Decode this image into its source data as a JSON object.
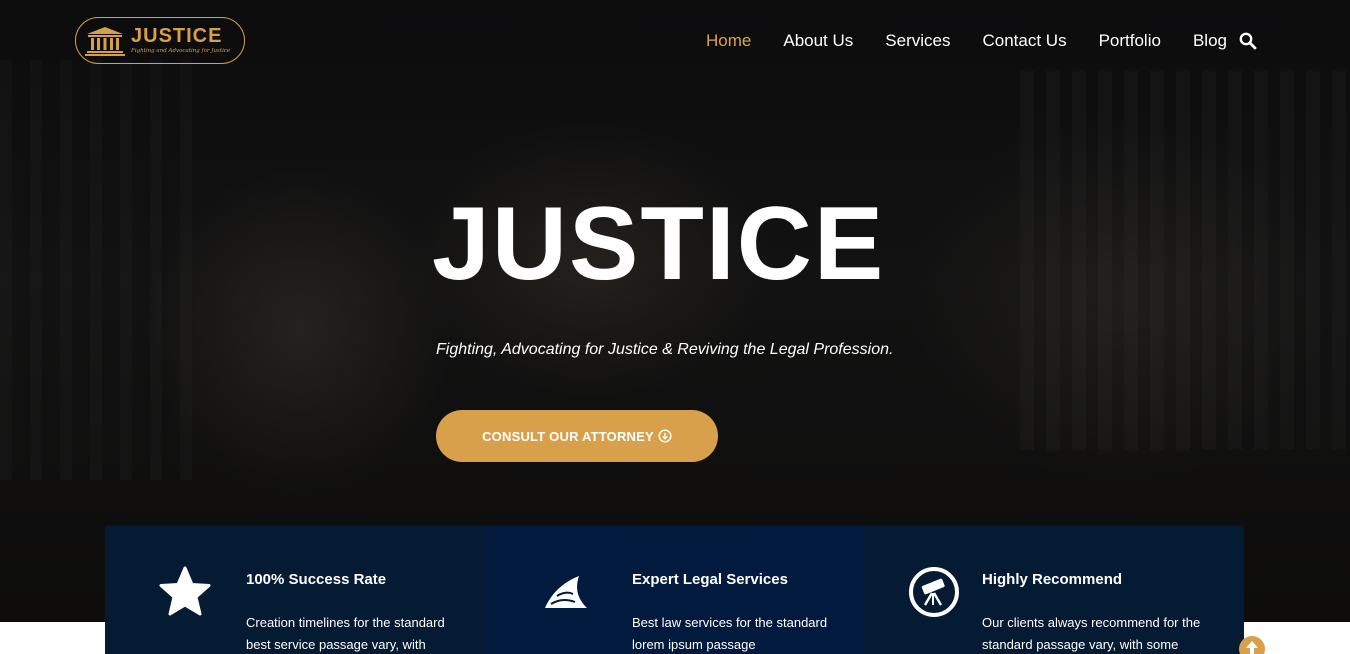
{
  "brand": {
    "name": "JUSTICE",
    "tagline": "Fighting and Advocating for Justice",
    "accent_color": "#d9a04b",
    "logo_icon": "courthouse-icon"
  },
  "nav": {
    "items": [
      {
        "label": "Home",
        "active": true
      },
      {
        "label": "About Us",
        "active": false
      },
      {
        "label": "Services",
        "active": false
      },
      {
        "label": "Contact Us",
        "active": false
      },
      {
        "label": "Portfolio",
        "active": false
      },
      {
        "label": "Blog",
        "active": false
      }
    ],
    "search_icon": "search-icon"
  },
  "hero": {
    "title": "JUSTICE",
    "subtitle": "Fighting, Advocating for Justice & Reviving the Legal Profession.",
    "cta_label": "CONSULT OUR ATTORNEY",
    "cta_icon": "arrow-circle-down-icon"
  },
  "features": [
    {
      "icon": "star-icon",
      "title": "100% Success Rate",
      "text": "Creation timelines for the standard best service  passage vary, with"
    },
    {
      "icon": "shark-fin-icon",
      "title": "Expert Legal Services",
      "text": "Best law services  for the standard lorem ipsum passage"
    },
    {
      "icon": "telescope-icon",
      "title": "Highly Recommend",
      "text": "Our clients always recommend for the standard  passage vary, with some"
    }
  ],
  "back_to_top_icon": "arrow-up-icon",
  "colors": {
    "feature_bg": "#051a33",
    "feature_bg_alt": "#021a3d",
    "nav_active": "#e0a24c"
  }
}
